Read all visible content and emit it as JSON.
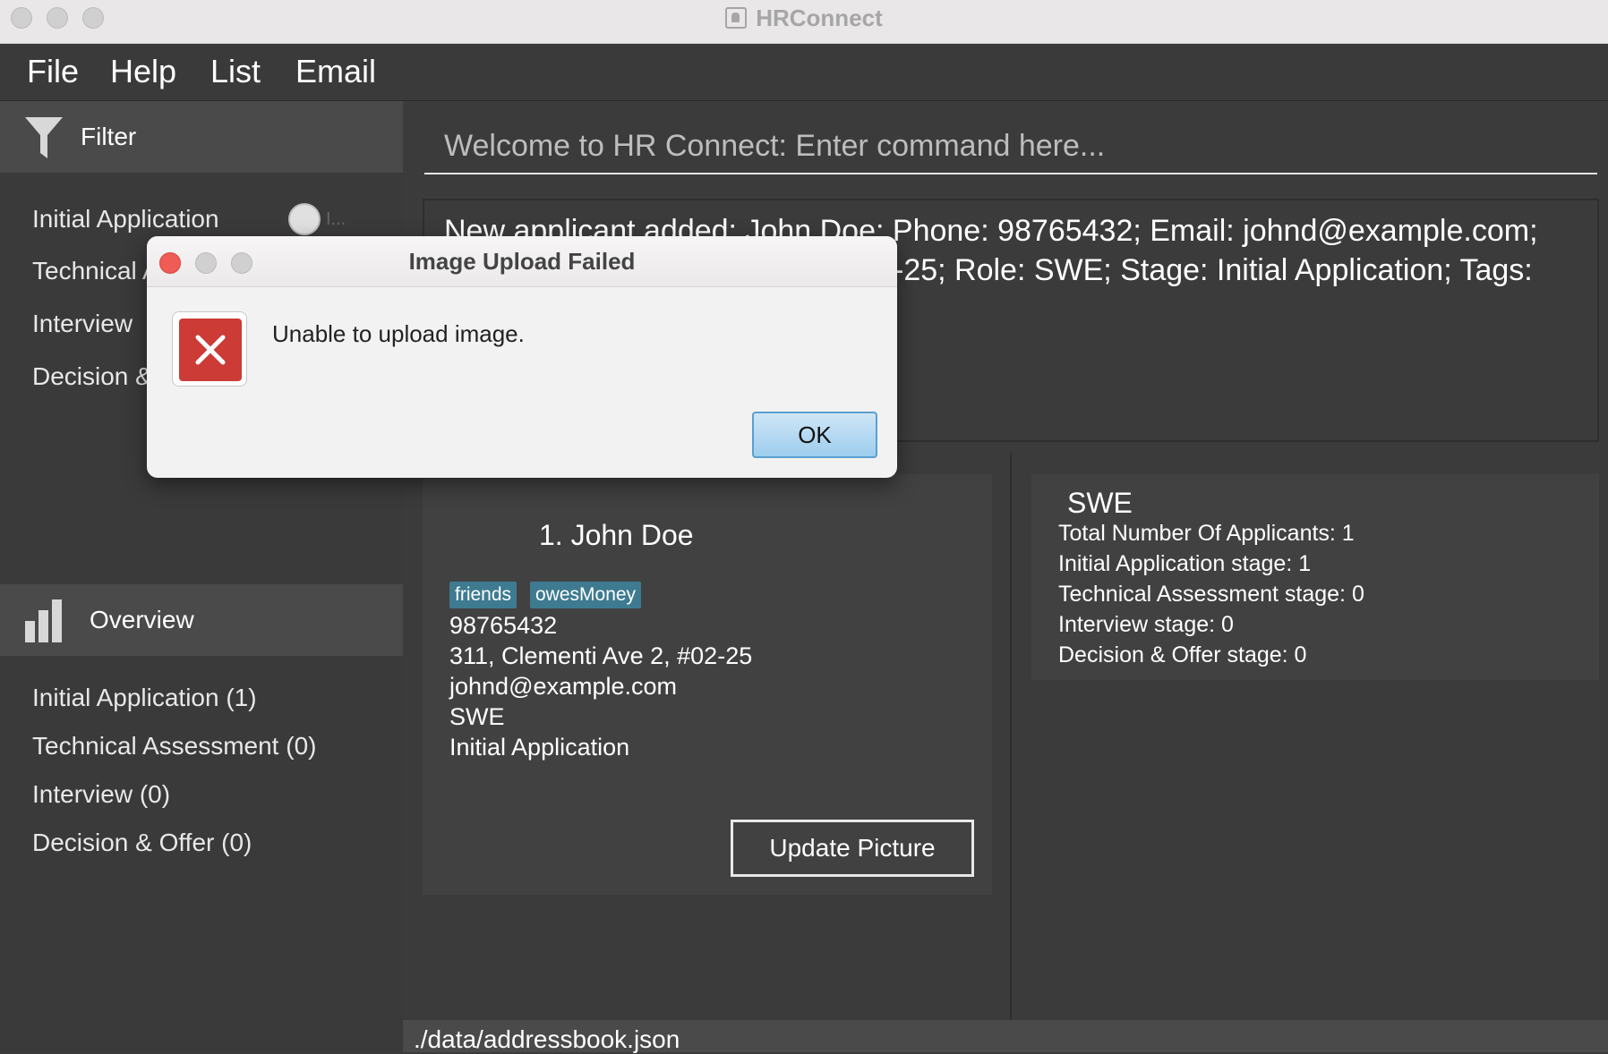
{
  "window": {
    "title": "HRConnect"
  },
  "menu": {
    "items": [
      "File",
      "Help",
      "List",
      "Email"
    ]
  },
  "sidebar": {
    "filter_label": "Filter",
    "filter_items": [
      "Initial Application",
      "Technical A",
      "Interview",
      "Decision &"
    ],
    "toggle_hint": "I...",
    "overview_label": "Overview",
    "overview_items": [
      "Initial Application (1)",
      "Technical Assessment (0)",
      "Interview (0)",
      "Decision & Offer (0)"
    ]
  },
  "command": {
    "placeholder": "Welcome to HR Connect: Enter command here..."
  },
  "result": {
    "line1": "New applicant added: John Doe; Phone: 98765432; Email: johnd@example.com;",
    "line2": "-25; Role: SWE; Stage: Initial Application; Tags:"
  },
  "applicant": {
    "index_name": "1.  John Doe",
    "tags": [
      "friends",
      "owesMoney"
    ],
    "phone": "98765432",
    "address": "311, Clementi Ave 2, #02-25",
    "email": "johnd@example.com",
    "role": "SWE",
    "stage": "Initial Application",
    "update_button": "Update Picture"
  },
  "stats": {
    "title": "SWE",
    "lines": [
      "Total Number Of Applicants: 1",
      "Initial Application stage: 1",
      "Technical Assessment stage: 0",
      "Interview stage: 0",
      "Decision & Offer stage: 0"
    ]
  },
  "status": {
    "path": "./data/addressbook.json"
  },
  "dialog": {
    "title": "Image Upload Failed",
    "message": "Unable to upload image.",
    "ok": "OK",
    "icon": "error-x-icon",
    "colors": {
      "close": "#ee5c55",
      "error": "#cc3b36",
      "ok_border": "#5a9fd1"
    }
  },
  "colors": {
    "tag": "#3e7b91",
    "background": "#3b3b3c"
  }
}
